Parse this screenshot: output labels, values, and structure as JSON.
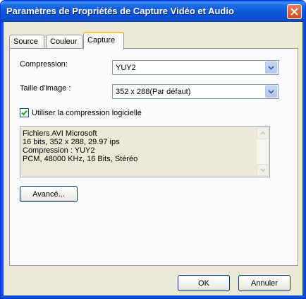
{
  "window": {
    "title": "Paramètres de Propriétés de Capture Vidéo et Audio",
    "close_symbol": "✕"
  },
  "tabs": [
    {
      "label": "Source",
      "active": false
    },
    {
      "label": "Couleur",
      "active": false
    },
    {
      "label": "Capture",
      "active": true
    }
  ],
  "capture": {
    "compression_label": "Compression:",
    "compression_value": "YUY2",
    "image_size_label": "Taille d'image :",
    "image_size_value": "352 x 288(Par défaut)",
    "software_compression_label": "Utiliser la compression logicielle",
    "software_compression_checked": true,
    "info_lines": [
      "Fichiers AVI Microsoft",
      "16 bits, 352 x 288, 29.97 ips",
      "Compression : YUY2",
      "PCM, 48000 KHz, 16 Bits, Stéréo"
    ],
    "advanced_button": "Avancé..."
  },
  "footer": {
    "ok_button": "OK",
    "cancel_button": "Annuler"
  },
  "icons": {
    "close": "close-icon",
    "dropdown": "chevron-down-icon",
    "check": "checkmark-icon",
    "scroll_up": "scroll-up-arrow-icon",
    "scroll_down": "scroll-down-arrow-icon"
  },
  "colors": {
    "titlebar": "#0a56d8",
    "window_bg": "#ece9d8",
    "close_button": "#cf4a27",
    "active_tab_accent": "#ffc73c"
  }
}
